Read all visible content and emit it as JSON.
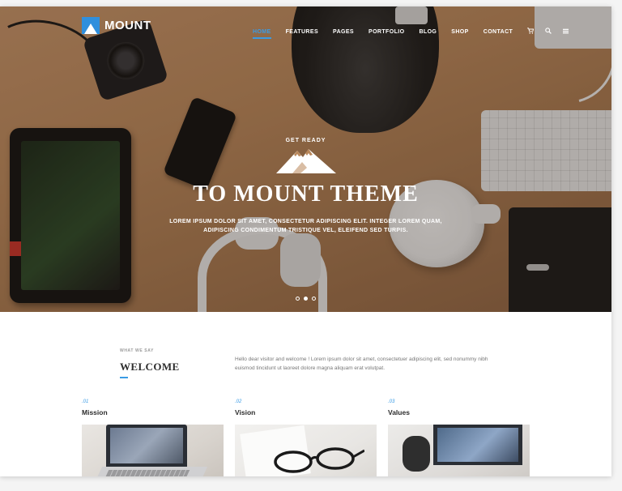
{
  "brand": {
    "name": "MOUNT",
    "accent_color": "#3a9be5"
  },
  "nav": {
    "items": [
      {
        "label": "HOME",
        "active": true
      },
      {
        "label": "FEATURES",
        "active": false
      },
      {
        "label": "PAGES",
        "active": false
      },
      {
        "label": "PORTFOLIO",
        "active": false
      },
      {
        "label": "BLOG",
        "active": false
      },
      {
        "label": "SHOP",
        "active": false
      },
      {
        "label": "CONTACT",
        "active": false
      }
    ],
    "icons": [
      "cart-icon",
      "search-icon",
      "menu-icon"
    ]
  },
  "hero": {
    "kicker": "GET READY",
    "title": "TO MOUNT THEME",
    "subtitle": "LOREM IPSUM DOLOR SIT AMET, CONSECTETUR ADIPISCING ELIT. INTEGER LOREM QUAM, ADIPISCING CONDIMENTUM TRISTIQUE VEL, ELEIFEND SED TURPIS.",
    "slides": {
      "count": 3,
      "active_index": 1
    }
  },
  "welcome": {
    "kicker": "WHAT WE SAY",
    "title": "WELCOME",
    "text": "Hello dear visitor and welcome ! Lorem ipsum dolor sit amet, consectetuer adipiscing elit, sed nonummy nibh euismod tincidunt ut laoreet dolore magna aliquam erat volutpat."
  },
  "cards": [
    {
      "number": ".01",
      "title": "Mission"
    },
    {
      "number": ".02",
      "title": "Vision"
    },
    {
      "number": ".03",
      "title": "Values"
    }
  ]
}
